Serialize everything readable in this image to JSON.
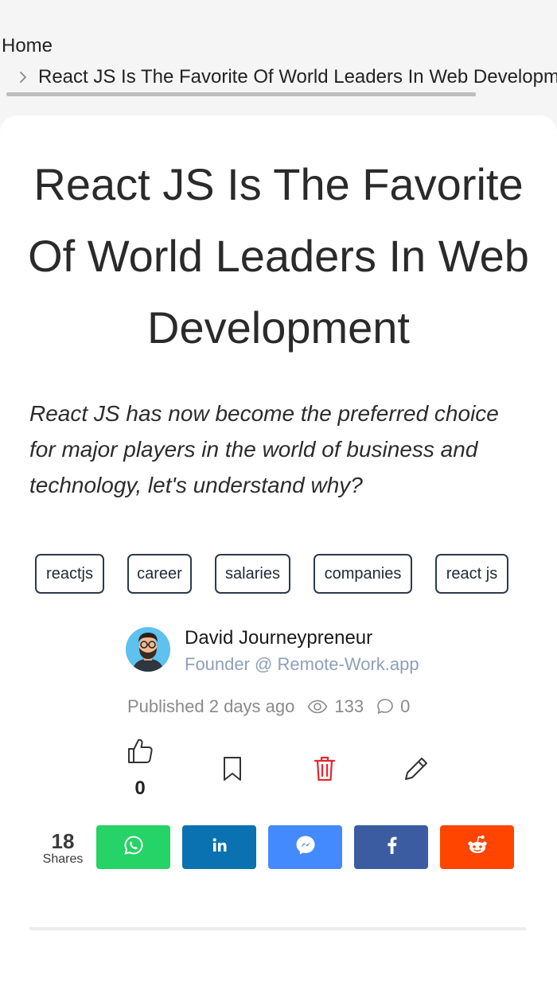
{
  "breadcrumb": {
    "home": "Home",
    "current": "React JS Is The Favorite Of World Leaders In Web Development"
  },
  "article": {
    "title": "React JS Is The Favorite Of World Leaders In Web Development",
    "subtitle": "React JS has now become the preferred choice for major players in the world of business and technology, let's understand why?",
    "tags": [
      "reactjs",
      "career",
      "salaries",
      "companies",
      "react js"
    ]
  },
  "author": {
    "name": "David Journeypreneur",
    "role": "Founder @ Remote-Work.app"
  },
  "meta": {
    "published": "Published 2 days ago",
    "views": "133",
    "comments": "0"
  },
  "actions": {
    "likes": "0",
    "icons": [
      "thumbs-up-icon",
      "bookmark-icon",
      "trash-icon",
      "pencil-icon"
    ],
    "delete_color": "#e8262b"
  },
  "shares": {
    "count": "18",
    "label": "Shares",
    "buttons": [
      {
        "name": "whatsapp",
        "color": "#25d366"
      },
      {
        "name": "linkedin",
        "color": "#0a72b1"
      },
      {
        "name": "messenger",
        "color": "#448aff"
      },
      {
        "name": "facebook",
        "color": "#3b5ca0"
      },
      {
        "name": "reddit",
        "color": "#ff4500"
      }
    ]
  }
}
